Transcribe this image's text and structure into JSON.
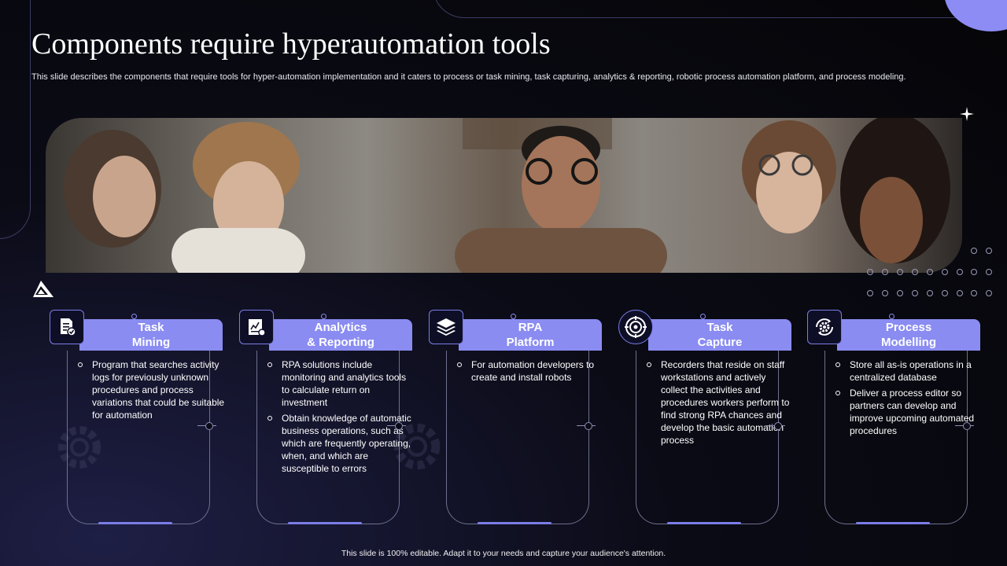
{
  "slide": {
    "title": "Components require hyperautomation tools",
    "subtitle": "This slide describes the components that require tools for hyper-automation implementation and it caters to process or task mining, task capturing, analytics & reporting, robotic process automation platform, and process modeling.",
    "footer": "This slide is 100% editable.  Adapt it to your needs and capture your audience's attention."
  },
  "colors": {
    "accent": "#8a8cf2",
    "background": "#0b0b16",
    "line": "#6e708f"
  },
  "cards": [
    {
      "title_line1": "Task",
      "title_line2": "Mining",
      "icon": "document-check-icon",
      "bullets": [
        "Program that searches activity logs for previously unknown procedures and process variations that could be suitable for automation"
      ]
    },
    {
      "title_line1": "Analytics",
      "title_line2": "& Reporting",
      "icon": "report-chart-icon",
      "bullets": [
        "RPA solutions include monitoring and analytics tools to calculate return on investment",
        "Obtain knowledge of automatic business operations, such as which are frequently operating, when, and which are susceptible to errors"
      ]
    },
    {
      "title_line1": "RPA",
      "title_line2": "Platform",
      "icon": "layers-icon",
      "bullets": [
        "For automation developers to create and install robots"
      ]
    },
    {
      "title_line1": "Task",
      "title_line2": "Capture",
      "icon": "target-capture-icon",
      "bullets": [
        "Recorders that reside on staff workstations and actively collect the activities and procedures workers perform to find strong RPA chances and develop the basic automation process"
      ]
    },
    {
      "title_line1": "Process",
      "title_line2": "Modelling",
      "icon": "gear-cycle-icon",
      "bullets": [
        "Store all as-is operations in a centralized database",
        "Deliver a process editor so partners can develop and improve upcoming automated procedures"
      ]
    }
  ]
}
